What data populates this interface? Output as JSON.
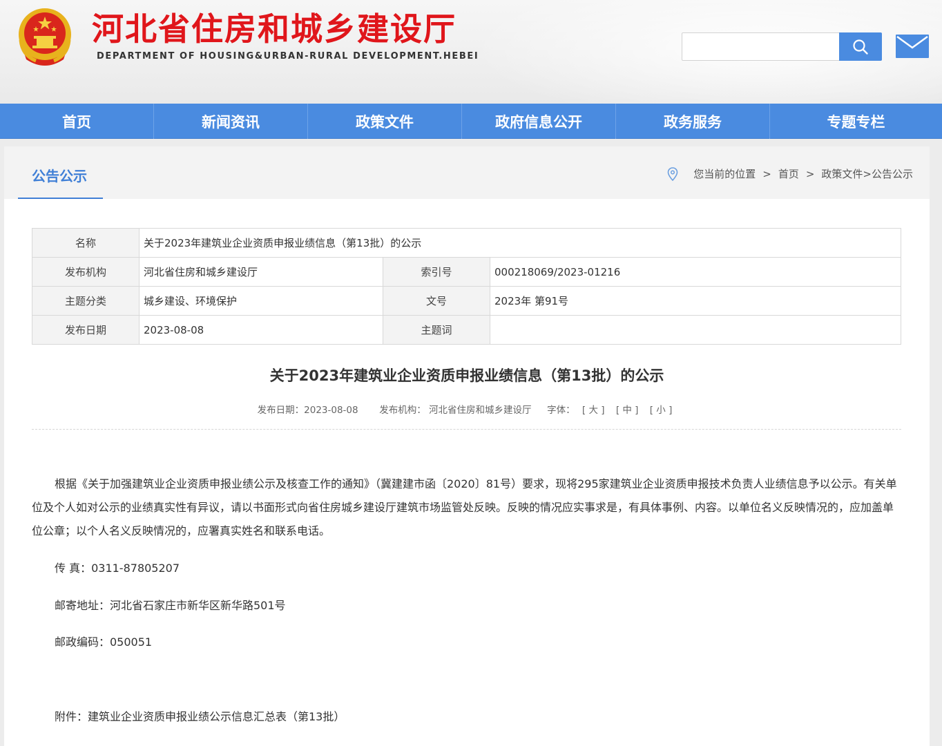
{
  "header": {
    "site_title": "河北省住房和城乡建设厅",
    "site_subtitle": "DEPARTMENT OF HOUSING&URBAN-RURAL DEVELOPMENT.HEBEI",
    "search_placeholder": "",
    "search_icon": "search-icon",
    "mail_icon": "mail-icon"
  },
  "nav": {
    "items": [
      "首页",
      "新闻资讯",
      "政策文件",
      "政府信息公开",
      "政务服务",
      "专题专栏"
    ]
  },
  "section": {
    "title": "公告公示",
    "location_label": "您当前的位置",
    "crumb_home": "首页",
    "crumb_path": "政策文件>公告公示",
    "sep": ">"
  },
  "info": {
    "name_label": "名称",
    "name_value": "关于2023年建筑业企业资质申报业绩信息（第13批）的公示",
    "org_label": "发布机构",
    "org_value": "河北省住房和城乡建设厅",
    "index_label": "索引号",
    "index_value": "000218069/2023-01216",
    "category_label": "主题分类",
    "category_value": "城乡建设、环境保护",
    "docno_label": "文号",
    "docno_value": "2023年 第91号",
    "date_label": "发布日期",
    "date_value": "2023-08-08",
    "keyword_label": "主题词",
    "keyword_value": ""
  },
  "article": {
    "title": "关于2023年建筑业企业资质申报业绩信息（第13批）的公示",
    "meta_date": "发布日期：2023-08-08",
    "meta_org": "发布机构：  河北省住房和城乡建设厅",
    "meta_font": "字体：",
    "font_large": "[ 大 ]",
    "font_medium": "[ 中 ]",
    "font_small": "[ 小 ]",
    "paragraph": "根据《关于加强建筑业企业资质申报业绩公示及核查工作的通知》（冀建建市函〔2020〕81号）要求，现将295家建筑业企业资质申报技术负责人业绩信息予以公示。有关单位及个人如对公示的业绩真实性有异议，请以书面形式向省住房城乡建设厅建筑市场监管处反映。反映的情况应实事求是，有具体事例、内容。以单位名义反映情况的，应加盖单位公章；以个人名义反映情况的，应署真实姓名和联系电话。",
    "fax": "传  真：0311-87805207",
    "address": "邮寄地址：河北省石家庄市新华区新华路501号",
    "postcode": "邮政编码：050051",
    "attachment": "附件：建筑业企业资质申报业绩公示信息汇总表（第13批）"
  }
}
